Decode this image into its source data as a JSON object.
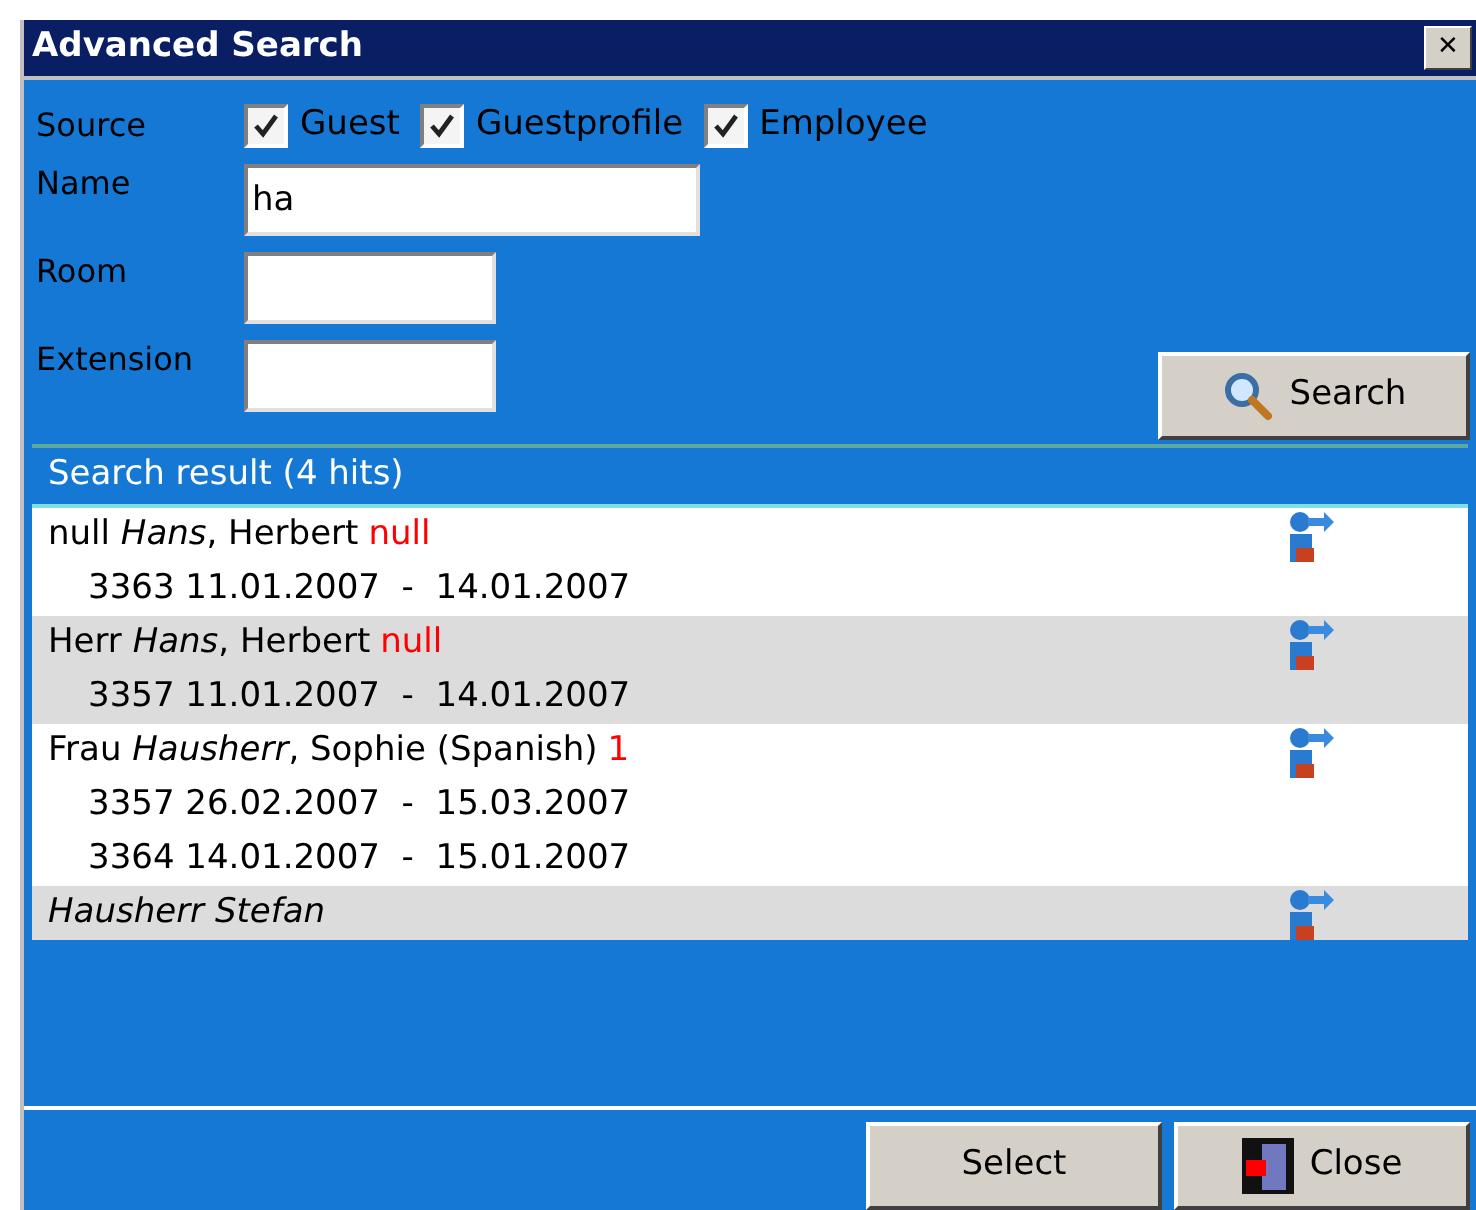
{
  "window": {
    "title": "Advanced Search",
    "close": "✕"
  },
  "source": {
    "label": "Source",
    "options": [
      {
        "label": "Guest",
        "checked": true
      },
      {
        "label": "Guestprofile",
        "checked": true
      },
      {
        "label": "Employee",
        "checked": true
      }
    ]
  },
  "fields": [
    {
      "label": "Name",
      "value": "ha"
    },
    {
      "label": "Room"
    },
    {
      "label": "Extension"
    }
  ],
  "search_button": "Search",
  "results": {
    "title": "Search result (4 hits)",
    "rows": [
      {
        "salutation": "null",
        "surname": "Hans",
        "rest": ", Herbert",
        "flag": "null",
        "stays": [
          "3363 11.01.2007  -  14.01.2007"
        ]
      },
      {
        "salutation": "Herr",
        "surname": "Hans",
        "rest": ", Herbert",
        "flag": "null",
        "stays": [
          "3357 11.01.2007  -  14.01.2007"
        ]
      },
      {
        "salutation": "Frau",
        "surname": "Hausherr",
        "rest": ", Sophie (Spanish)",
        "flag": "1",
        "stays": [
          "3357 26.02.2007  -  15.03.2007",
          "3364 14.01.2007  -  15.01.2007"
        ]
      },
      {
        "surname": "Hausherr Stefan"
      }
    ]
  },
  "buttons": [
    {
      "label": "Select",
      "kind": "select"
    },
    {
      "label": "Close",
      "kind": "close"
    }
  ]
}
